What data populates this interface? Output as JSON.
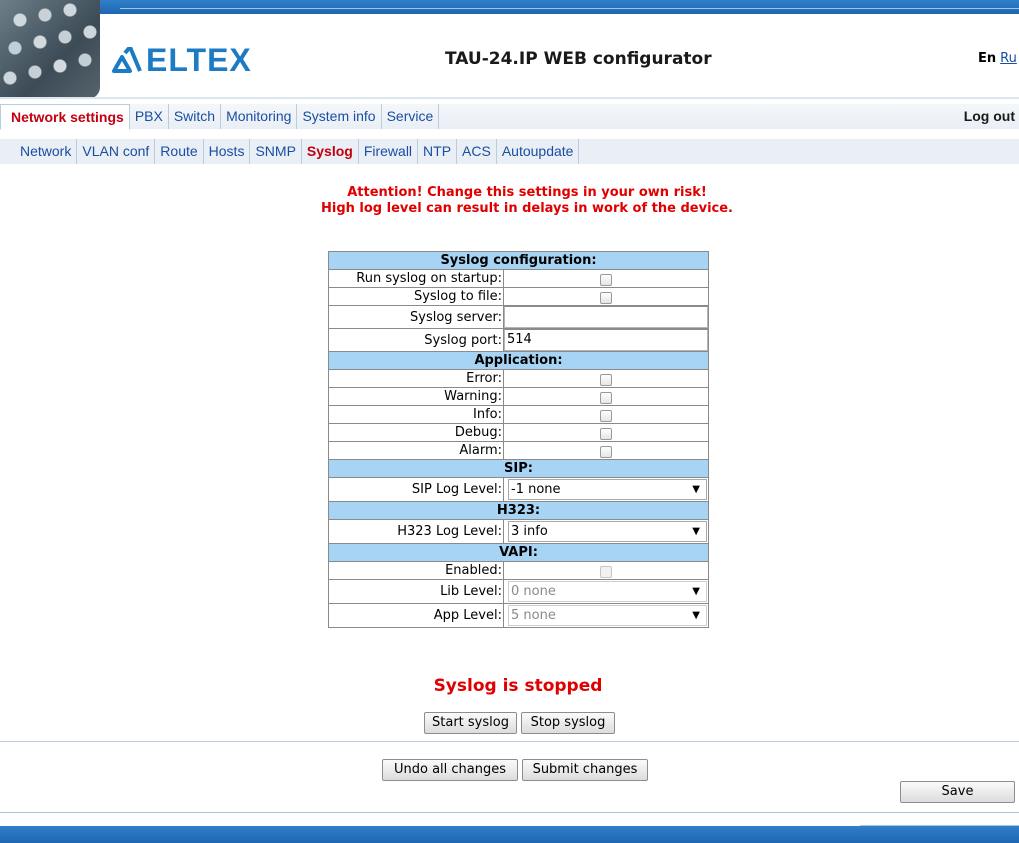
{
  "header": {
    "logo_text": "ELTEX",
    "title": "TAU-24.IP WEB configurator",
    "lang_en": "En",
    "lang_ru": "Ru"
  },
  "main_nav": {
    "tabs": [
      {
        "label": "Network settings",
        "active": true
      },
      {
        "label": "PBX",
        "active": false
      },
      {
        "label": "Switch",
        "active": false
      },
      {
        "label": "Monitoring",
        "active": false
      },
      {
        "label": "System info",
        "active": false
      },
      {
        "label": "Service",
        "active": false
      }
    ],
    "logout": "Log out"
  },
  "sub_nav": {
    "tabs": [
      {
        "label": "Network",
        "active": false
      },
      {
        "label": "VLAN conf",
        "active": false
      },
      {
        "label": "Route",
        "active": false
      },
      {
        "label": "Hosts",
        "active": false
      },
      {
        "label": "SNMP",
        "active": false
      },
      {
        "label": "Syslog",
        "active": true
      },
      {
        "label": "Firewall",
        "active": false
      },
      {
        "label": "NTP",
        "active": false
      },
      {
        "label": "ACS",
        "active": false
      },
      {
        "label": "Autoupdate",
        "active": false
      }
    ]
  },
  "warning": {
    "line1": "Attention! Change this settings in your own risk!",
    "line2": "High log level can result in delays in work of the device."
  },
  "config": {
    "syslog_section": "Syslog configuration:",
    "run_on_startup_label": "Run syslog on startup:",
    "syslog_to_file_label": "Syslog to file:",
    "syslog_server_label": "Syslog server:",
    "syslog_server_value": "",
    "syslog_port_label": "Syslog port:",
    "syslog_port_value": "514",
    "application_section": "Application:",
    "error_label": "Error:",
    "warning_label": "Warning:",
    "info_label": "Info:",
    "debug_label": "Debug:",
    "alarm_label": "Alarm:",
    "sip_section": "SIP:",
    "sip_log_level_label": "SIP Log Level:",
    "sip_log_level_value": "-1 none",
    "h323_section": "H323:",
    "h323_log_level_label": "H323 Log Level:",
    "h323_log_level_value": "3 info",
    "vapi_section": "VAPI:",
    "enabled_label": "Enabled:",
    "lib_level_label": "Lib Level:",
    "lib_level_value": "0 none",
    "app_level_label": "App Level:",
    "app_level_value": "5 none"
  },
  "status": "Syslog is stopped",
  "buttons": {
    "start_syslog": "Start syslog",
    "stop_syslog": "Stop syslog",
    "undo_all": "Undo all changes",
    "submit": "Submit changes",
    "save": "Save"
  },
  "colors": {
    "accent_blue": "#1f66b0",
    "section_header": "#a7d4f4",
    "alert_red": "#e00000",
    "active_tab_red": "#c2000f",
    "link_blue": "#1a4ea3"
  },
  "icons": {
    "dropdown_arrow": "chevron-down-icon",
    "checkbox": "checkbox-icon"
  }
}
